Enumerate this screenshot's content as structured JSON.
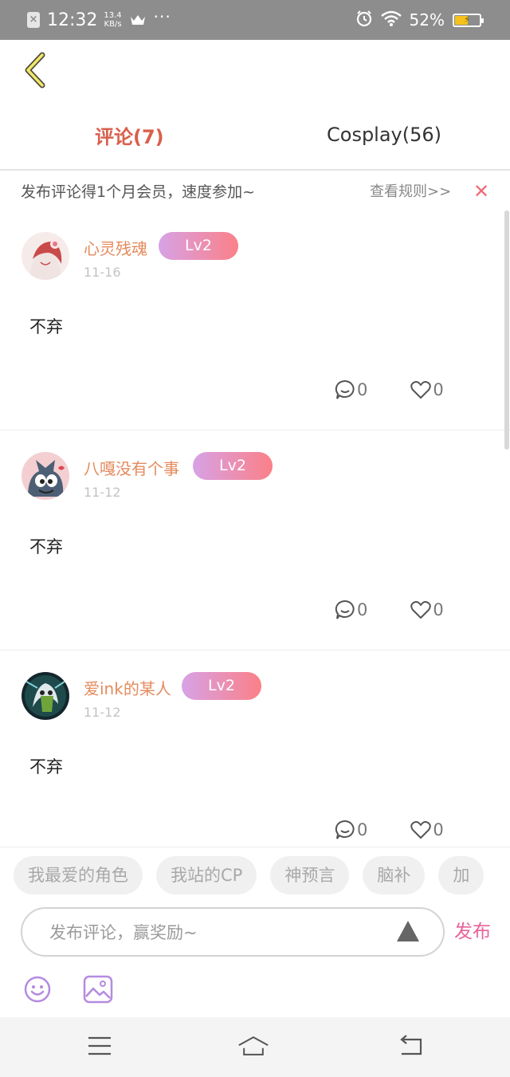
{
  "status_bar": {
    "time": "12:32",
    "speed_value": "13.4",
    "speed_unit": "KB/s",
    "dots": "···",
    "battery_percent": "52%",
    "battery_level": 0.52,
    "colors": {
      "background": "#8d8d8d",
      "battery_fill": "#f4c21a"
    }
  },
  "header": {
    "back_icon": "chevron-left-icon",
    "tabs": [
      {
        "label": "评论(7)",
        "active": true
      },
      {
        "label": "Cosplay(56)",
        "active": false
      }
    ],
    "active_color": "#d9604c"
  },
  "notice": {
    "text": "发布评论得1个月会员，速度参加~",
    "rules_link": "查看规则>>",
    "close_icon": "✕"
  },
  "comments": [
    {
      "username": "心灵残魂",
      "level": "Lv2",
      "date": "11-16",
      "content": "不弃",
      "reply_count": "0",
      "like_count": "0"
    },
    {
      "username": "八嘎没有个事",
      "level": "Lv2",
      "date": "11-12",
      "content": "不弃",
      "reply_count": "0",
      "like_count": "0"
    },
    {
      "username": "爱ink的某人",
      "level": "Lv2",
      "date": "11-12",
      "content": "不弃",
      "reply_count": "0",
      "like_count": "0"
    }
  ],
  "composer": {
    "chips": [
      "我最爱的角色",
      "我站的CP",
      "神预言",
      "脑补",
      "加"
    ],
    "placeholder": "发布评论，赢奖励~",
    "publish_label": "发布",
    "icons": [
      "emoji-icon",
      "image-icon",
      "send-arrow-icon"
    ],
    "accent_color": "#e8619a"
  },
  "nav_bar": {
    "icons": [
      "menu-icon",
      "home-icon",
      "back-nav-icon"
    ]
  }
}
